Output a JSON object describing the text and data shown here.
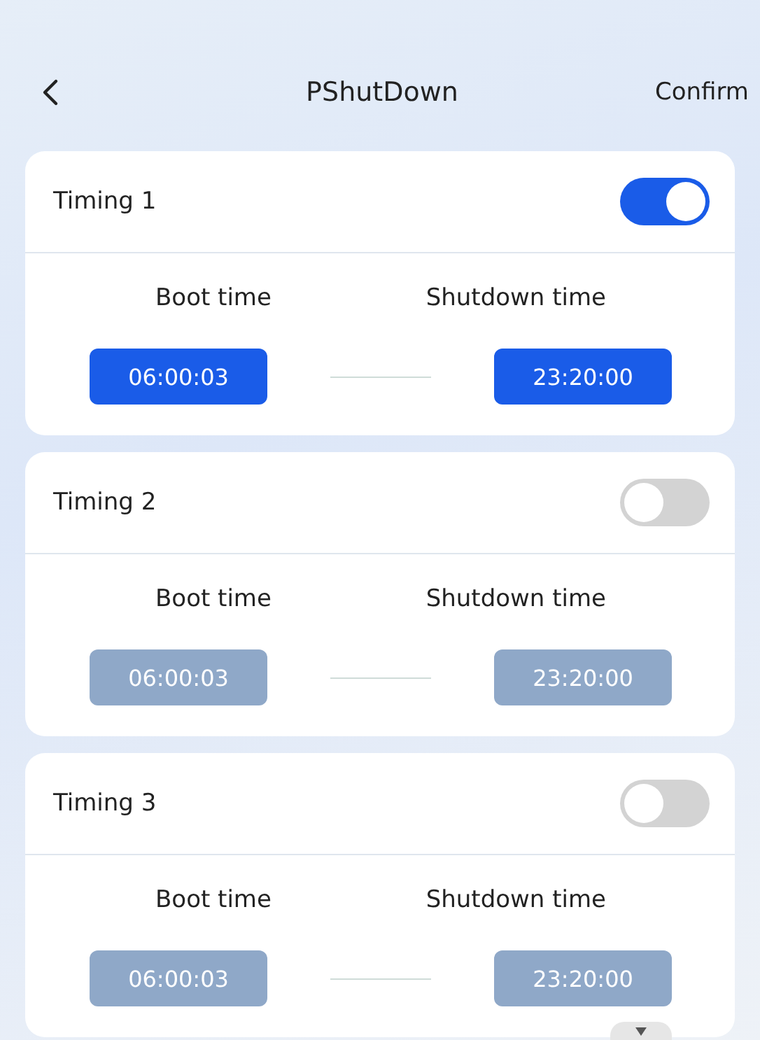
{
  "header": {
    "title": "PShutDown",
    "confirm": "Confirm"
  },
  "timings": [
    {
      "label": "Timing 1",
      "on": true,
      "boot_label": "Boot time",
      "shutdown_label": "Shutdown time",
      "boot": "06:00:03",
      "shutdown": "23:20:00"
    },
    {
      "label": "Timing 2",
      "on": false,
      "boot_label": "Boot time",
      "shutdown_label": "Shutdown time",
      "boot": "06:00:03",
      "shutdown": "23:20:00"
    },
    {
      "label": "Timing 3",
      "on": false,
      "boot_label": "Boot time",
      "shutdown_label": "Shutdown time",
      "boot": "06:00:03",
      "shutdown": "23:20:00"
    }
  ]
}
